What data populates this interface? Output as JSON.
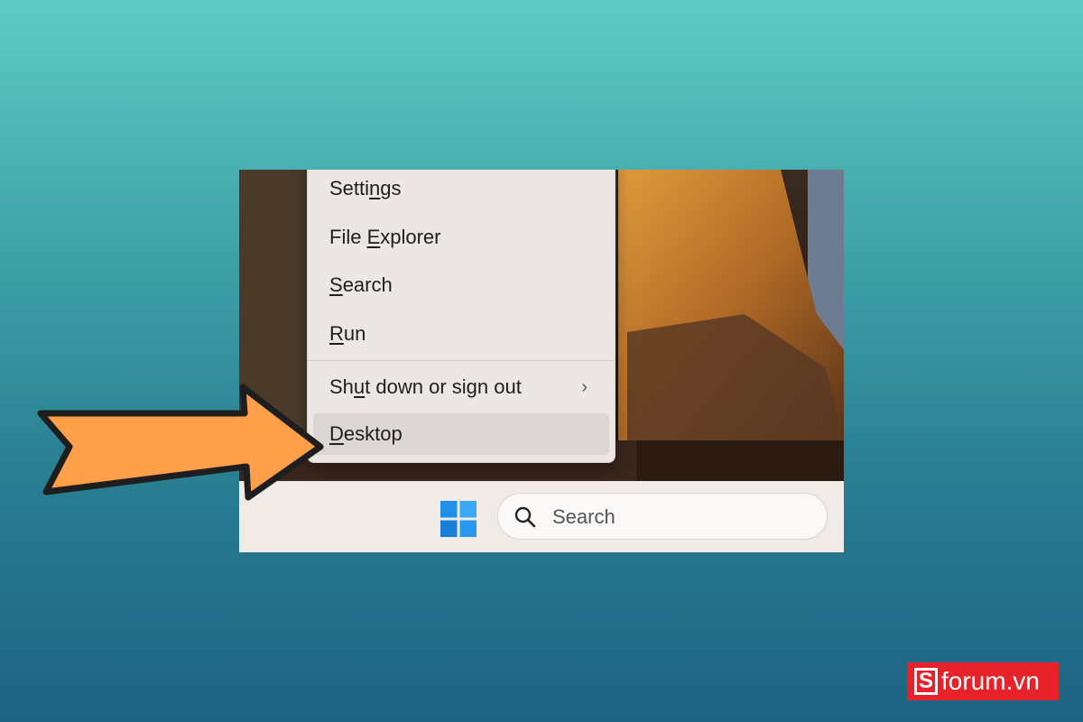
{
  "menu": {
    "items": [
      {
        "prefix": "Setti",
        "underline": "n",
        "suffix": "gs"
      },
      {
        "prefix": "File ",
        "underline": "E",
        "suffix": "xplorer"
      },
      {
        "prefix": "",
        "underline": "S",
        "suffix": "earch"
      },
      {
        "prefix": "",
        "underline": "R",
        "suffix": "un"
      },
      {
        "prefix": "Sh",
        "underline": "u",
        "suffix": "t down or sign out",
        "chevron": "›"
      },
      {
        "prefix": "",
        "underline": "D",
        "suffix": "esktop"
      }
    ]
  },
  "taskbar": {
    "search_label": "Search",
    "start_icon": "windows-logo-icon",
    "search_icon": "search-icon"
  },
  "annotation": {
    "arrow_icon": "pointer-arrow-icon",
    "arrow_color": "#ff9f4a"
  },
  "brand": {
    "mark": "S",
    "text": "forum.vn",
    "color": "#e8222a"
  }
}
